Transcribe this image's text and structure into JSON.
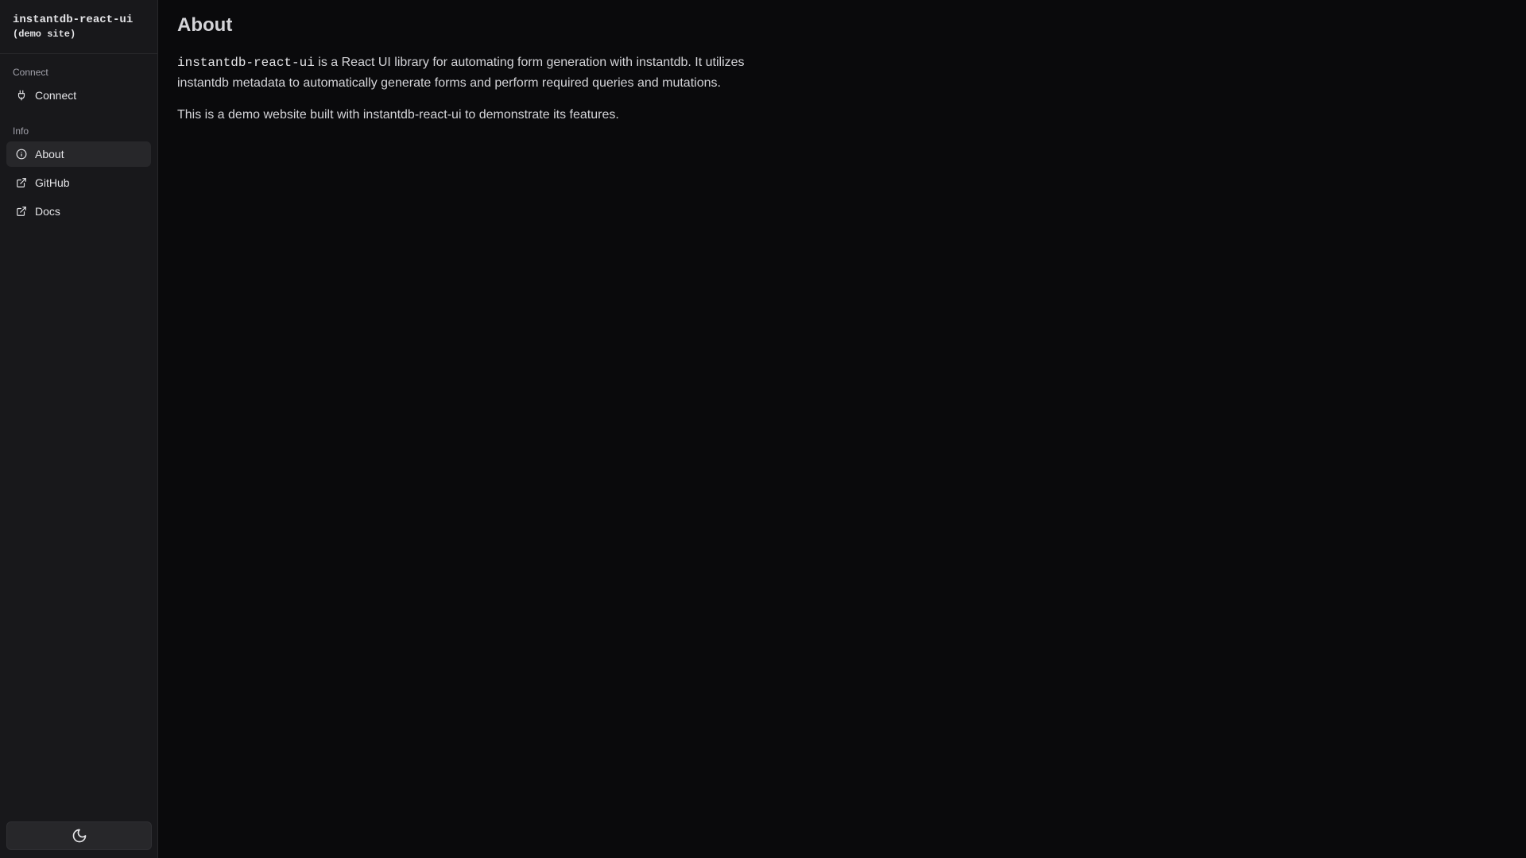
{
  "brand": {
    "name": "instantdb-react-ui",
    "subtitle": "(demo site)"
  },
  "sidebar": {
    "groups": [
      {
        "label": "Connect",
        "items": [
          {
            "label": "Connect",
            "icon": "plug-icon"
          }
        ]
      },
      {
        "label": "Info",
        "items": [
          {
            "label": "About",
            "icon": "info-icon",
            "active": true
          },
          {
            "label": "GitHub",
            "icon": "external-link-icon"
          },
          {
            "label": "Docs",
            "icon": "external-link-icon"
          }
        ]
      }
    ],
    "theme_toggle_icon": "moon-icon"
  },
  "main": {
    "title": "About",
    "paragraph1_code": "instantdb-react-ui",
    "paragraph1_text": " is a React UI library for automating form generation with instantdb. It utilizes instantdb metadata to automatically generate forms and perform required queries and mutations.",
    "paragraph2": "This is a demo website built with instantdb-react-ui to demonstrate its features."
  },
  "colors": {
    "background": "#0a0a0c",
    "sidebar": "#18181b",
    "active_item": "#27272a",
    "text": "#d4d4d8"
  }
}
